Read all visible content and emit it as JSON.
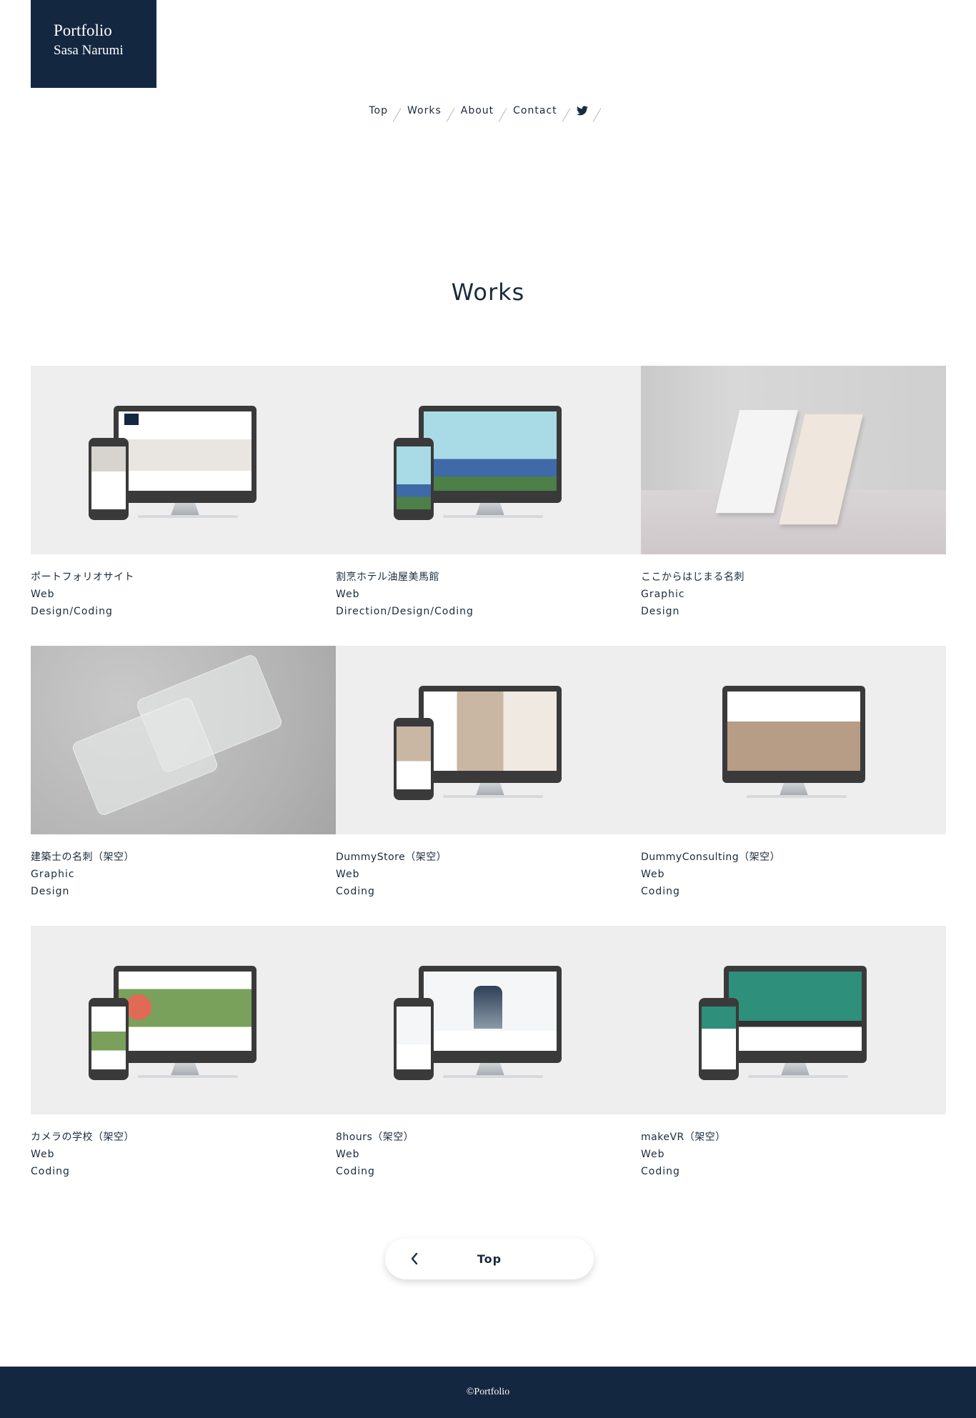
{
  "brand": {
    "line1": "Portfolio",
    "line2": "Sasa Narumi",
    "color": "#142740"
  },
  "nav": {
    "items": [
      "Top",
      "Works",
      "About",
      "Contact"
    ],
    "twitter_icon": "twitter-icon"
  },
  "section_title": "Works",
  "works": [
    {
      "title": "ポートフォリオサイト",
      "category": "Web",
      "role": "Design/Coding",
      "thumb": "device-mockup"
    },
    {
      "title": "割烹ホテル油屋美馬館",
      "category": "Web",
      "role": "Direction/Design/Coding",
      "thumb": "device-mockup"
    },
    {
      "title": "ここからはじまる名刺",
      "category": "Graphic",
      "role": "Design",
      "thumb": "business-cards"
    },
    {
      "title": "建築士の名刺（架空）",
      "category": "Graphic",
      "role": "Design",
      "thumb": "clear-cards"
    },
    {
      "title": "DummyStore（架空）",
      "category": "Web",
      "role": "Coding",
      "thumb": "device-mockup"
    },
    {
      "title": "DummyConsulting（架空）",
      "category": "Web",
      "role": "Coding",
      "thumb": "monitor-only"
    },
    {
      "title": "カメラの学校（架空）",
      "category": "Web",
      "role": "Coding",
      "thumb": "device-mockup"
    },
    {
      "title": "8hours（架空）",
      "category": "Web",
      "role": "Coding",
      "thumb": "device-mockup"
    },
    {
      "title": "makeVR（架空）",
      "category": "Web",
      "role": "Coding",
      "thumb": "device-mockup"
    }
  ],
  "back_button": {
    "label": "Top",
    "icon": "chevron-left-icon"
  },
  "footer": {
    "copyright": "©Portfolio"
  }
}
